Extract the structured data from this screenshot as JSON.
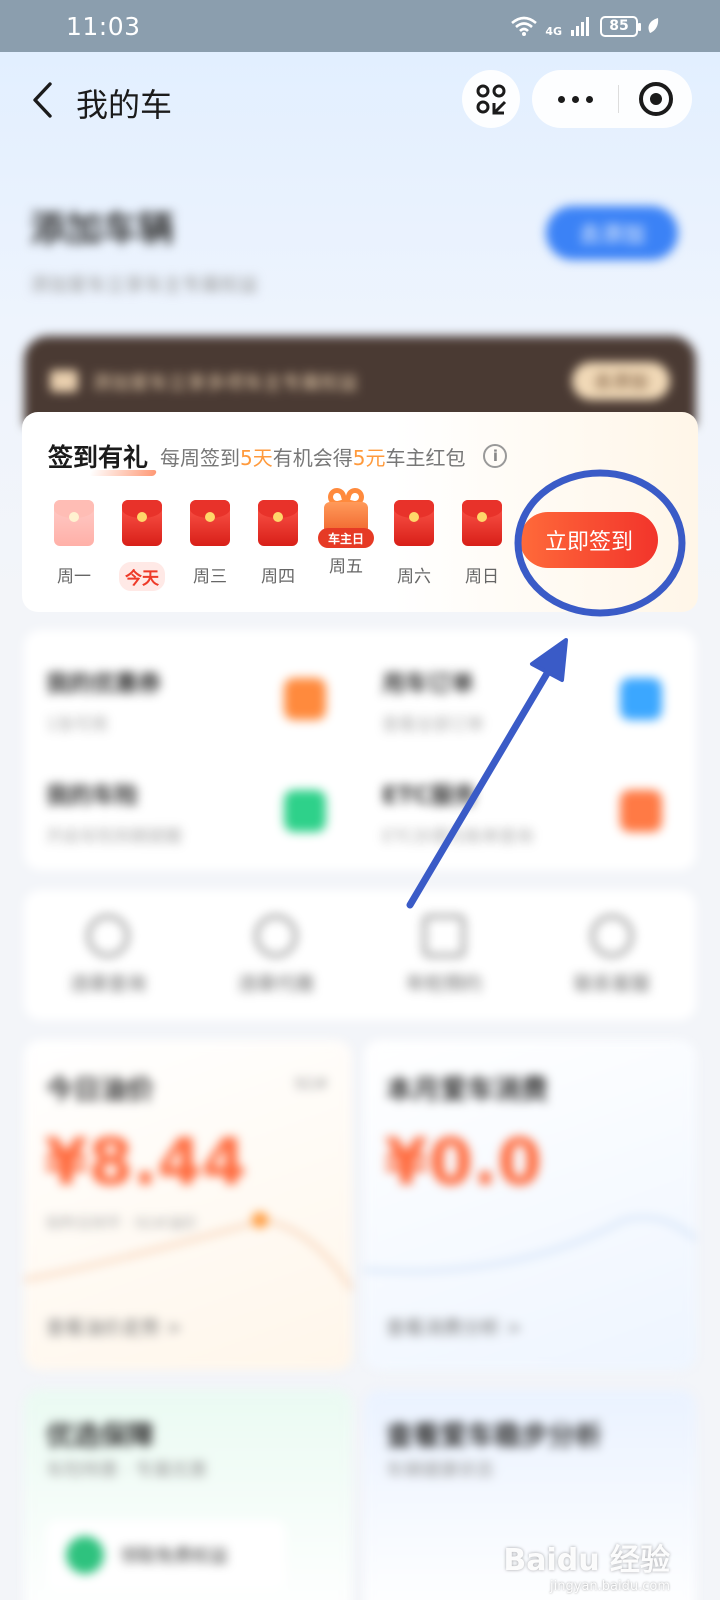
{
  "status_bar": {
    "time": "11:03",
    "network": "4G",
    "battery": "85"
  },
  "header": {
    "title": "我的车"
  },
  "add_vehicle": {
    "title": "添加车辆",
    "subtitle": "添加爱车立享车主专属权益",
    "button": "去添加"
  },
  "vip_banner": {
    "text": "添加爱车立享多项车主专属权益",
    "button": "去添加"
  },
  "signin": {
    "title": "签到有礼",
    "subtitle_parts": [
      "每周签到",
      "5天",
      "有机会得",
      "5元",
      "车主红包"
    ],
    "button": "立即签到",
    "days": [
      {
        "label": "周一",
        "state": "past"
      },
      {
        "label": "今天",
        "state": "today"
      },
      {
        "label": "周三",
        "state": "future"
      },
      {
        "label": "周四",
        "state": "future"
      },
      {
        "label": "周五",
        "state": "gift",
        "tag": "车主日"
      },
      {
        "label": "周六",
        "state": "future"
      },
      {
        "label": "周日",
        "state": "future"
      }
    ]
  },
  "services": [
    {
      "title": "我的优惠券",
      "subtitle": "1张可用",
      "color": "#ff8a3d"
    },
    {
      "title": "用车订单",
      "subtitle": "查看全部订单",
      "color": "#3ba7ff"
    },
    {
      "title": "我的车险",
      "subtitle": "开启车险到期提醒",
      "color": "#2ed18a"
    },
    {
      "title": "ETC服务",
      "subtitle": "ETC办理与账单查询",
      "color": "#ff7a45"
    }
  ],
  "tools": [
    {
      "label": "违章查询"
    },
    {
      "label": "违章代缴"
    },
    {
      "label": "年检预约"
    },
    {
      "label": "联系客服"
    }
  ],
  "fuel_price": {
    "title": "今日油价",
    "tag": "92#",
    "value": "¥8.44",
    "note": "较昨日持平 · 92#油价",
    "link": "查看油价走势 >"
  },
  "car_spend": {
    "title": "本月爱车消费",
    "value": "¥0.0",
    "link": "查看消费分析 >"
  },
  "bottom": [
    {
      "title": "优选保障",
      "subtitle": "车险特惠 · 专属优惠"
    },
    {
      "title": "查看爱车稳步分析",
      "subtitle": "车辆健康状态"
    }
  ],
  "promo": {
    "text": "领取免费权益"
  },
  "watermark": {
    "brand": "Baidu 经验",
    "url": "jingyan.baidu.com"
  },
  "colors": {
    "accent": "#f2342b",
    "highlight": "#ff9a3c",
    "annotation": "#3a5bc7"
  }
}
